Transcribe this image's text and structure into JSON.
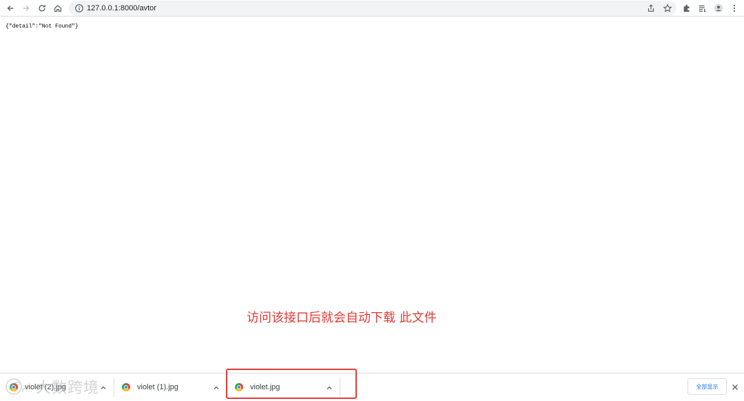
{
  "browser": {
    "url": "127.0.0.1:8000/avtor"
  },
  "icons": {
    "back": "back-arrow-icon",
    "forward": "forward-arrow-icon",
    "reload": "reload-icon",
    "home": "home-icon",
    "site_info": "info-icon",
    "share": "share-icon",
    "bookmark": "star-icon",
    "extensions": "puzzle-icon",
    "reading_list": "reading-list-icon",
    "profile": "profile-icon",
    "menu": "kebab-menu-icon"
  },
  "page": {
    "body_text": "{\"detail\":\"Not Found\"}"
  },
  "annotation": {
    "text": "访问该接口后就会自动下载 此文件",
    "color": "#e53935"
  },
  "downloads": {
    "items": [
      {
        "filename": "violet (2).jpg"
      },
      {
        "filename": "violet (1).jpg"
      },
      {
        "filename": "violet.jpg"
      }
    ],
    "show_all_label": "全部显示"
  },
  "watermark": {
    "text": "大数跨境"
  }
}
